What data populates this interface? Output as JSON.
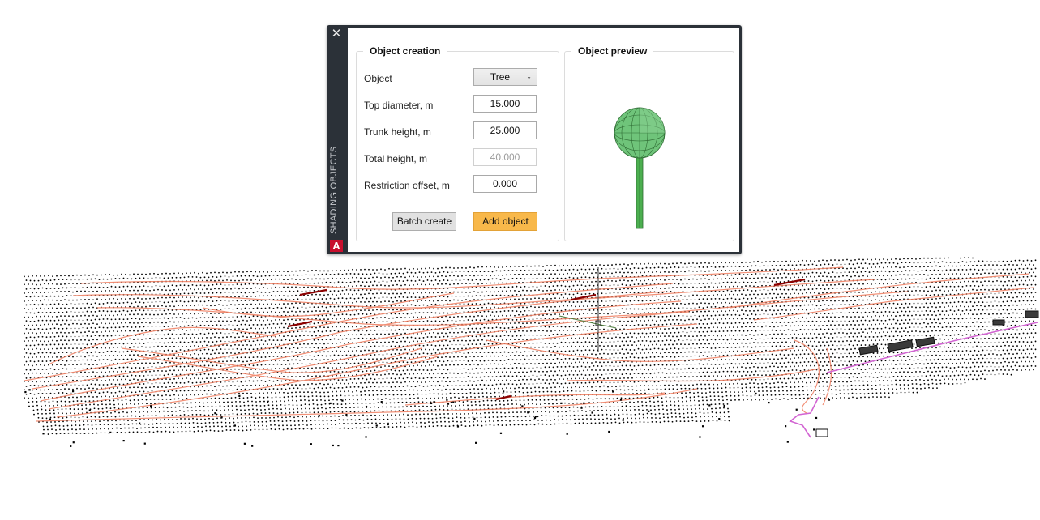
{
  "palette": {
    "side_title": "SHADING OBJECTS",
    "close_icon": "close-icon",
    "logo_letter": "A",
    "accent_color": "#f8b84a",
    "frame_color": "#2b3138"
  },
  "creation": {
    "title": "Object creation",
    "object_label": "Object",
    "object_value": "Tree",
    "top_diameter_label": "Top diameter, m",
    "top_diameter_value": "15.000",
    "trunk_height_label": "Trunk height, m",
    "trunk_height_value": "25.000",
    "total_height_label": "Total height, m",
    "total_height_value": "40.000",
    "restriction_offset_label": "Restriction offset, m",
    "restriction_offset_value": "0.000",
    "batch_create_label": "Batch create",
    "add_object_label": "Add object"
  },
  "preview": {
    "title": "Object preview",
    "object_icon": "tree-3d-model",
    "crown_color": "#6fc47a",
    "trunk_color": "#4caf50"
  },
  "viewport": {
    "contour_color": "#f07c5e",
    "grid_dot_color": "#000000",
    "road_color": "#d264d2"
  }
}
